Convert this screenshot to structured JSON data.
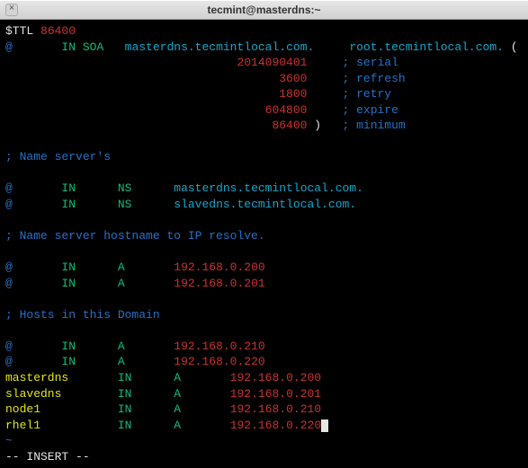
{
  "titlebar": {
    "close": "×",
    "title": "tecmint@masterdns:~"
  },
  "ttl": {
    "directive": "$TTL",
    "value": "86400"
  },
  "soa": {
    "origin": "@",
    "in": "IN",
    "type": "SOA",
    "primary": "masterdns.tecmintlocal.com.",
    "mail": "root.tecmintlocal.com.",
    "paren_open": "(",
    "serial": "2014090401",
    "serial_c": "; serial",
    "refresh": "3600",
    "refresh_c": "; refresh",
    "retry": "1800",
    "retry_c": "; retry",
    "expire": "604800",
    "expire_c": "; expire",
    "minimum": "86400",
    "paren_close": ")",
    "minimum_c": "; minimum"
  },
  "comments": {
    "ns": "; Name server's",
    "ip": "; Name server hostname to IP resolve.",
    "hosts": "; Hosts in this Domain"
  },
  "ns": [
    {
      "origin": "@",
      "in": "IN",
      "type": "NS",
      "value": "masterdns.tecmintlocal.com."
    },
    {
      "origin": "@",
      "in": "IN",
      "type": "NS",
      "value": "slavedns.tecmintlocal.com."
    }
  ],
  "a_server": [
    {
      "origin": "@",
      "in": "IN",
      "type": "A",
      "value": "192.168.0.200"
    },
    {
      "origin": "@",
      "in": "IN",
      "type": "A",
      "value": "192.168.0.201"
    }
  ],
  "a_hosts": [
    {
      "origin": "@",
      "in": "IN",
      "type": "A",
      "value": "192.168.0.210"
    },
    {
      "origin": "@",
      "in": "IN",
      "type": "A",
      "value": "192.168.0.220"
    }
  ],
  "named_hosts": [
    {
      "name": "masterdns",
      "in": "IN",
      "type": "A",
      "value": "192.168.0.200"
    },
    {
      "name": "slavedns",
      "in": "IN",
      "type": "A",
      "value": "192.168.0.201"
    },
    {
      "name": "node1",
      "in": "IN",
      "type": "A",
      "value": "192.168.0.210"
    },
    {
      "name": "rhel1",
      "in": "IN",
      "type": "A",
      "value": "192.168.0.22"
    }
  ],
  "last_char": "0",
  "tilde": "~",
  "mode": "-- INSERT --"
}
